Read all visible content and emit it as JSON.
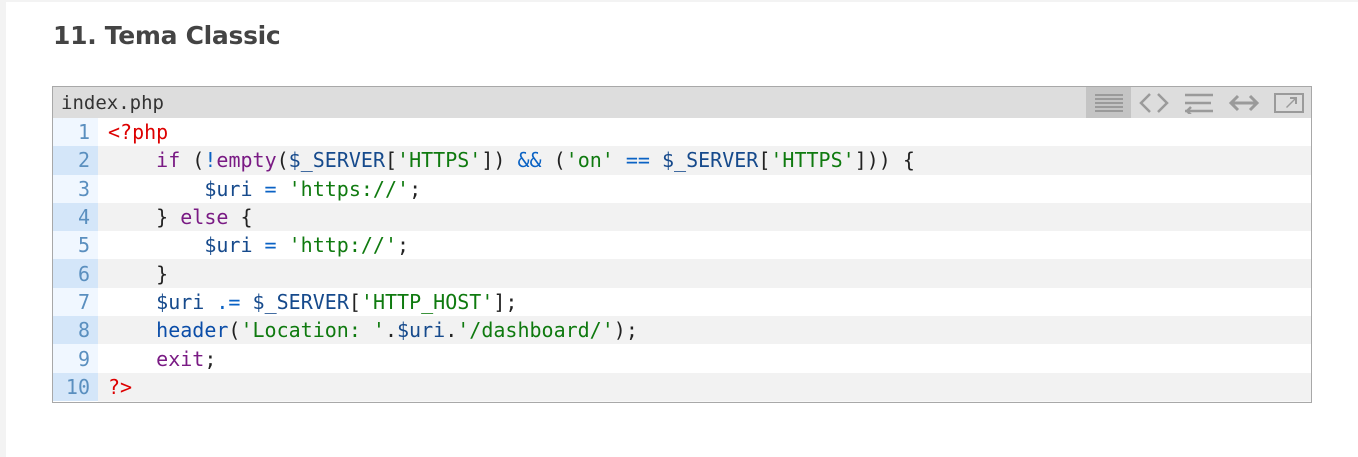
{
  "heading": "11. Tema Classic",
  "codebox": {
    "filename": "index.php",
    "toolbar": [
      {
        "name": "view-source-icon",
        "title": "View source"
      },
      {
        "name": "code-brackets-icon",
        "title": "Toggle code"
      },
      {
        "name": "wrap-lines-icon",
        "title": "Wrap lines"
      },
      {
        "name": "expand-icon",
        "title": "Expand"
      },
      {
        "name": "popout-icon",
        "title": "Open in new window"
      }
    ],
    "lines": [
      {
        "n": "1",
        "tokens": [
          [
            "tag",
            "<?php"
          ]
        ]
      },
      {
        "n": "2",
        "tokens": [
          [
            "def",
            "    "
          ],
          [
            "kw",
            "if"
          ],
          [
            "def",
            " ("
          ],
          [
            "op",
            "!"
          ],
          [
            "fn",
            "empty"
          ],
          [
            "def",
            "("
          ],
          [
            "var",
            "$_SERVER"
          ],
          [
            "def",
            "["
          ],
          [
            "str",
            "'HTTPS'"
          ],
          [
            "def",
            "]) "
          ],
          [
            "op",
            "&&"
          ],
          [
            "def",
            " ("
          ],
          [
            "str",
            "'on'"
          ],
          [
            "def",
            " "
          ],
          [
            "op",
            "=="
          ],
          [
            "def",
            " "
          ],
          [
            "var",
            "$_SERVER"
          ],
          [
            "def",
            "["
          ],
          [
            "str",
            "'HTTPS'"
          ],
          [
            "def",
            "])) {"
          ]
        ]
      },
      {
        "n": "3",
        "tokens": [
          [
            "def",
            "        "
          ],
          [
            "var",
            "$uri"
          ],
          [
            "def",
            " "
          ],
          [
            "op",
            "="
          ],
          [
            "def",
            " "
          ],
          [
            "str",
            "'https://'"
          ],
          [
            "def",
            ";"
          ]
        ]
      },
      {
        "n": "4",
        "tokens": [
          [
            "def",
            "    } "
          ],
          [
            "kw",
            "else"
          ],
          [
            "def",
            " {"
          ]
        ]
      },
      {
        "n": "5",
        "tokens": [
          [
            "def",
            "        "
          ],
          [
            "var",
            "$uri"
          ],
          [
            "def",
            " "
          ],
          [
            "op",
            "="
          ],
          [
            "def",
            " "
          ],
          [
            "str",
            "'http://'"
          ],
          [
            "def",
            ";"
          ]
        ]
      },
      {
        "n": "6",
        "tokens": [
          [
            "def",
            "    }"
          ]
        ]
      },
      {
        "n": "7",
        "tokens": [
          [
            "def",
            "    "
          ],
          [
            "var",
            "$uri"
          ],
          [
            "def",
            " "
          ],
          [
            "op",
            ".="
          ],
          [
            "def",
            " "
          ],
          [
            "var",
            "$_SERVER"
          ],
          [
            "def",
            "["
          ],
          [
            "str",
            "'HTTP_HOST'"
          ],
          [
            "def",
            "];"
          ]
        ]
      },
      {
        "n": "8",
        "tokens": [
          [
            "def",
            "    "
          ],
          [
            "fnb",
            "header"
          ],
          [
            "def",
            "("
          ],
          [
            "str",
            "'Location: '"
          ],
          [
            "def",
            "."
          ],
          [
            "var",
            "$uri"
          ],
          [
            "def",
            "."
          ],
          [
            "str",
            "'/dashboard/'"
          ],
          [
            "def",
            ");"
          ]
        ]
      },
      {
        "n": "9",
        "tokens": [
          [
            "def",
            "    "
          ],
          [
            "kw",
            "exit"
          ],
          [
            "def",
            ";"
          ]
        ]
      },
      {
        "n": "10",
        "tokens": [
          [
            "tag",
            "?>"
          ]
        ]
      }
    ]
  }
}
